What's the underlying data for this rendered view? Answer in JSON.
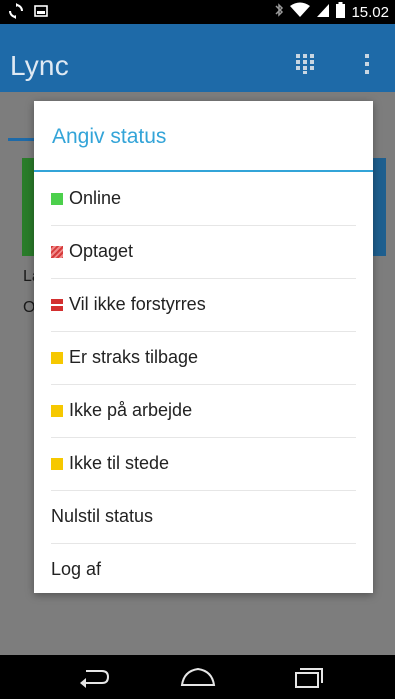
{
  "status_bar": {
    "time": "15.02",
    "icons": [
      "sync-icon",
      "screenshot-icon",
      "bluetooth-icon",
      "wifi-icon",
      "signal-icon",
      "battery-icon"
    ]
  },
  "app_bar": {
    "title": "Lync",
    "icons": [
      "dialpad-icon",
      "overflow-menu-icon"
    ],
    "color": "#1e6aa8"
  },
  "background": {
    "tile_text_1": "La",
    "tile_text_2": "O"
  },
  "dialog": {
    "title": "Angiv status",
    "accent": "#33a4d8",
    "items": [
      {
        "label": "Online",
        "indicator": "online",
        "color": "#4cd04c"
      },
      {
        "label": "Optaget",
        "indicator": "busy",
        "color": "#d63a3a"
      },
      {
        "label": "Vil ikke forstyrres",
        "indicator": "do-not-disturb",
        "color": "#d32f2f"
      },
      {
        "label": "Er straks tilbage",
        "indicator": "away",
        "color": "#f6c800"
      },
      {
        "label": "Ikke på arbejde",
        "indicator": "away",
        "color": "#f6c800"
      },
      {
        "label": "Ikke til stede",
        "indicator": "away",
        "color": "#f6c800"
      },
      {
        "label": "Nulstil status",
        "indicator": ""
      },
      {
        "label": "Log af",
        "indicator": ""
      }
    ]
  },
  "nav_bar": {
    "buttons": [
      "back-icon",
      "home-icon",
      "recent-apps-icon"
    ]
  }
}
